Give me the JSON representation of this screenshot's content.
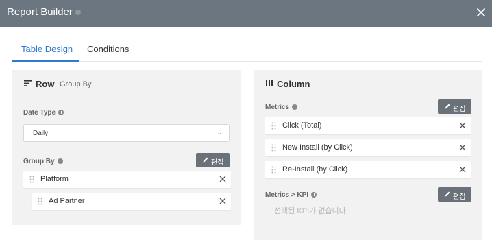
{
  "dialog": {
    "title": "Report Builder",
    "close_icon": "close-icon"
  },
  "tabs": [
    {
      "label": "Table Design",
      "active": true
    },
    {
      "label": "Conditions",
      "active": false
    }
  ],
  "row_panel": {
    "title": "Row",
    "subtitle": "Group By",
    "date_type": {
      "label": "Date Type",
      "value": "Daily"
    },
    "group_by": {
      "label": "Group By",
      "edit_label": "편집",
      "items": [
        {
          "label": "Platform"
        },
        {
          "label": "Ad Partner"
        }
      ]
    }
  },
  "column_panel": {
    "title": "Column",
    "metrics": {
      "label": "Metrics",
      "edit_label": "편집",
      "items": [
        {
          "label": "Click (Total)"
        },
        {
          "label": "New Install (by Click)"
        },
        {
          "label": "Re-Install (by Click)"
        }
      ]
    },
    "kpi": {
      "label": "Metrics > KPI",
      "edit_label": "편집",
      "empty_text": "선택된 KPI가 없습니다."
    }
  },
  "colors": {
    "header": "#6c7680",
    "accent": "#2e7ad0",
    "panel": "#f2f2f3",
    "button": "#6b7179"
  }
}
